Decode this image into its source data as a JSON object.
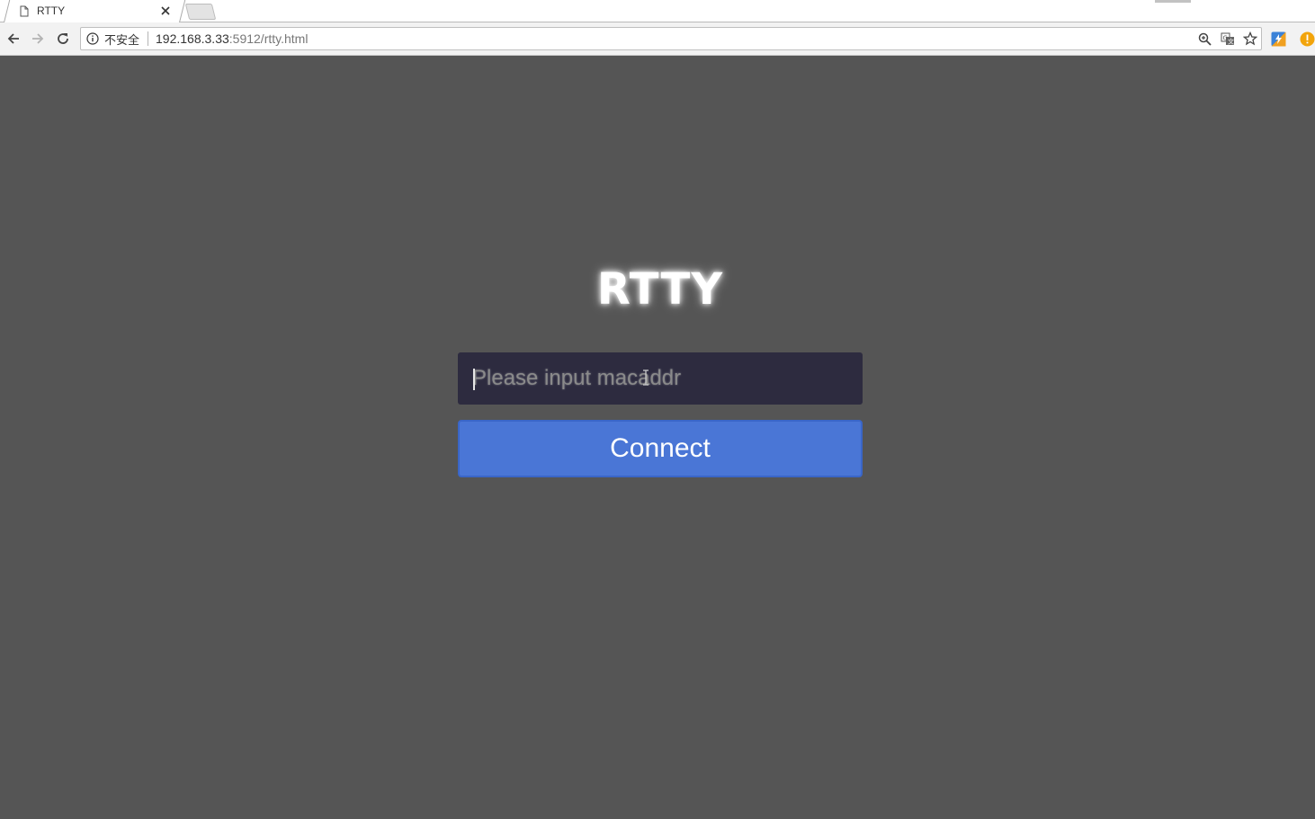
{
  "tab": {
    "title": "RTTY"
  },
  "toolbar": {
    "security_label": "不安全",
    "url_host": "192.168.3.33",
    "url_rest": ":5912/rtty.html"
  },
  "page": {
    "title": "RTTY",
    "input_placeholder": "Please input macaddr",
    "connect_label": "Connect"
  },
  "colors": {
    "page_bg": "#555555",
    "input_bg": "#2d2b3f",
    "button_bg": "#4a76d6",
    "title_color": "#ffffff"
  },
  "icons": {
    "tab_favicon": "page-icon",
    "tab_close": "close-icon",
    "back": "back-arrow-icon",
    "forward": "forward-arrow-icon",
    "reload": "reload-icon",
    "site_info": "info-icon",
    "zoom": "zoom-icon",
    "translate": "translate-icon",
    "bookmark": "star-icon",
    "extension": "extension-icon",
    "alert": "alert-icon"
  }
}
